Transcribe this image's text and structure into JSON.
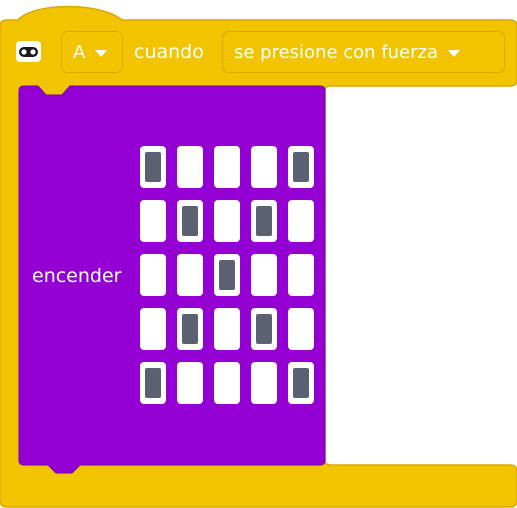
{
  "hat_block": {
    "icon": "microbit-board-icon",
    "button_dropdown": {
      "value": "A"
    },
    "when_label": "cuando",
    "event_dropdown": {
      "value": "se presione con fuerza"
    },
    "color": "#f2c400"
  },
  "inner_block": {
    "label": "encender",
    "color": "#9400d3",
    "led_grid": [
      [
        1,
        0,
        0,
        0,
        1
      ],
      [
        0,
        1,
        0,
        1,
        0
      ],
      [
        0,
        0,
        1,
        0,
        0
      ],
      [
        0,
        1,
        0,
        1,
        0
      ],
      [
        1,
        0,
        0,
        0,
        1
      ]
    ]
  }
}
